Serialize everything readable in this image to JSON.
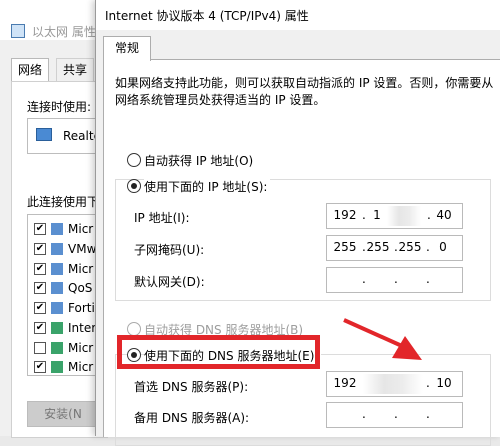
{
  "background_dialog": {
    "title": "以太网 属性",
    "tabs": [
      "网络",
      "共享"
    ],
    "connect_using_label": "连接时使用:",
    "adapter_name": "Realte",
    "components_label": "此连接使用下",
    "components": [
      {
        "checked": true,
        "label": "Micr"
      },
      {
        "checked": true,
        "label": "VMw"
      },
      {
        "checked": true,
        "label": "Micr"
      },
      {
        "checked": true,
        "label": "QoS"
      },
      {
        "checked": true,
        "label": "Forti"
      },
      {
        "checked": true,
        "label": "Intern"
      },
      {
        "checked": false,
        "label": "Micr"
      },
      {
        "checked": true,
        "label": "Micr"
      }
    ],
    "install_button": "安装(N"
  },
  "dialog": {
    "title": "Internet 协议版本 4 (TCP/IPv4) 属性",
    "tab": "常规",
    "description": "如果网络支持此功能，则可以获取自动指派的 IP 设置。否则，你需要从网络系统管理员处获得适当的 IP 设置。",
    "auto_ip_label": "自动获得 IP 地址(O)",
    "manual_ip_label": "使用下面的 IP 地址(S):",
    "ip_label": "IP 地址(I):",
    "ip_value": [
      "192",
      "1",
      "",
      "40"
    ],
    "subnet_label": "子网掩码(U):",
    "subnet_value": [
      "255",
      "255",
      "255",
      "0"
    ],
    "gateway_label": "默认网关(D):",
    "gateway_value": [
      "",
      "",
      "",
      ""
    ],
    "auto_dns_label": "自动获得 DNS 服务器地址(B)",
    "manual_dns_label": "使用下面的 DNS 服务器地址(E):",
    "preferred_dns_label": "首选 DNS 服务器(P):",
    "preferred_dns_value": [
      "192",
      "",
      "",
      "10"
    ],
    "alternate_dns_label": "备用 DNS 服务器(A):",
    "alternate_dns_value": [
      "",
      "",
      "",
      ""
    ],
    "selected_ip_mode": "manual",
    "selected_dns_mode": "manual"
  },
  "colors": {
    "highlight": "#e2262a"
  }
}
